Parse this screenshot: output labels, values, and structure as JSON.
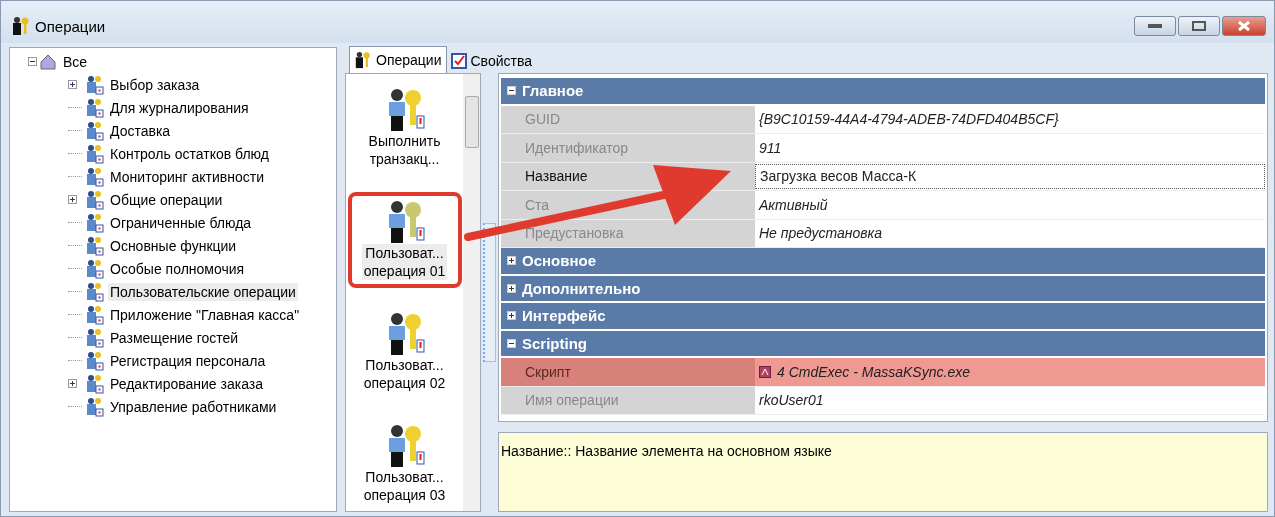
{
  "window": {
    "title": "Операции"
  },
  "tree": {
    "root": {
      "label": "Все",
      "expanded": true
    },
    "items": [
      {
        "label": "Выбор заказа",
        "expandable": true,
        "selected": false
      },
      {
        "label": "Для журналирования",
        "expandable": false,
        "selected": false
      },
      {
        "label": "Доставка",
        "expandable": false,
        "selected": false
      },
      {
        "label": "Контроль остатков блюд",
        "expandable": false,
        "selected": false
      },
      {
        "label": "Мониторинг активности",
        "expandable": false,
        "selected": false
      },
      {
        "label": "Общие операции",
        "expandable": true,
        "selected": false
      },
      {
        "label": "Ограниченные блюда",
        "expandable": false,
        "selected": false
      },
      {
        "label": "Основные функции",
        "expandable": false,
        "selected": false
      },
      {
        "label": "Особые полномочия",
        "expandable": false,
        "selected": false
      },
      {
        "label": "Пользовательские операции",
        "expandable": false,
        "selected": true
      },
      {
        "label": "Приложение \"Главная касса\"",
        "expandable": false,
        "selected": false
      },
      {
        "label": "Размещение гостей",
        "expandable": false,
        "selected": false
      },
      {
        "label": "Регистрация персонала",
        "expandable": false,
        "selected": false
      },
      {
        "label": "Редактирование заказа",
        "expandable": true,
        "selected": false
      },
      {
        "label": "Управление работниками",
        "expandable": false,
        "selected": false
      }
    ]
  },
  "tabs": [
    {
      "label": "Операции",
      "selected": true
    },
    {
      "label": "Свойства",
      "selected": false
    }
  ],
  "operations": [
    {
      "line1": "Выполнить",
      "line2": "транзакц...",
      "selected": false,
      "highlighted": false
    },
    {
      "line1": "Пользоват...",
      "line2": "операция 01",
      "selected": true,
      "highlighted": true
    },
    {
      "line1": "Пользоват...",
      "line2": "операция 02",
      "selected": false,
      "highlighted": false
    },
    {
      "line1": "Пользоват...",
      "line2": "операция 03",
      "selected": false,
      "highlighted": false
    }
  ],
  "properties": [
    {
      "title": "Главное",
      "expanded": true,
      "rows": [
        {
          "label": "GUID",
          "value": "{B9C10159-44A4-4794-ADEB-74DFD404B5CF}",
          "disabled": true,
          "editing": false,
          "highlighted": false
        },
        {
          "label": "Идентификатор",
          "value": "911",
          "disabled": true,
          "editing": false,
          "highlighted": false
        },
        {
          "label": "Название",
          "value": "Загрузка весов Масса-К",
          "disabled": false,
          "editing": true,
          "highlighted": false
        },
        {
          "label": "Ста",
          "value": "Активный",
          "disabled": true,
          "editing": false,
          "highlighted": false
        },
        {
          "label": "Предустановка",
          "value": "Не предустановка",
          "disabled": true,
          "editing": false,
          "highlighted": false
        }
      ]
    },
    {
      "title": "Основное",
      "expanded": false
    },
    {
      "title": "Дополнительно",
      "expanded": false
    },
    {
      "title": "Интерфейс",
      "expanded": false
    },
    {
      "title": "Scripting",
      "expanded": true,
      "rows": [
        {
          "label": "Скрипт",
          "value": "4 CmdExec - MassaKSync.exe",
          "disabled": true,
          "editing": false,
          "highlighted": true,
          "kind": "script"
        },
        {
          "label": "Имя операции",
          "value": "rkoUser01",
          "disabled": true,
          "editing": false,
          "highlighted": false
        }
      ]
    }
  ],
  "description": "Название:: Название элемента на основном языке"
}
